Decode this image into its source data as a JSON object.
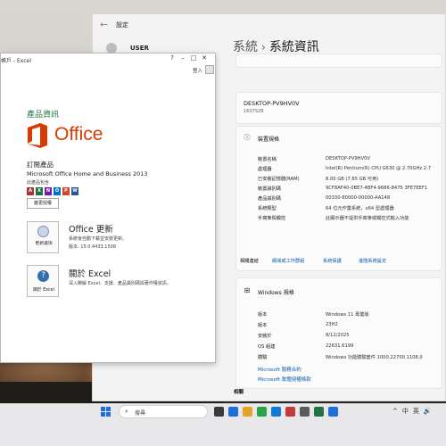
{
  "settings": {
    "title": "設定",
    "user": "USER",
    "breadcrumb_root": "系統",
    "breadcrumb_sep": "›",
    "breadcrumb_page": "系統資訊",
    "device_name": "DESKTOP-PV9HV0V",
    "device_model": "1607S2B",
    "device_specs_heading": "裝置規格",
    "specs": [
      {
        "key": "裝置名稱",
        "value": "DESKTOP-PV9HV0V"
      },
      {
        "key": "處理器",
        "value": "Intel(R) Pentium(R) CPU G630 @ 2.70GHz   2.7"
      },
      {
        "key": "已安裝記憶體(RAM)",
        "value": "8.00 GB (7.85 GB 可用)"
      },
      {
        "key": "裝置識別碼",
        "value": "9CF8AF40-0BE7-4BF4-9686-8475 3FE7EEF1"
      },
      {
        "key": "產品識別碼",
        "value": "00330-80000-00000-AA148"
      },
      {
        "key": "系統類型",
        "value": "64 位元作業系統，x64 型處理器"
      },
      {
        "key": "手寫筆與觸控",
        "value": "此顯示器不提供手寫筆或觸控式輸入功能"
      }
    ],
    "related_links_label": "相關連結",
    "related_links": [
      "網域或工作群組",
      "系統保護",
      "進階系統設定"
    ],
    "windows_specs_heading": "Windows 規格",
    "win_specs": [
      {
        "key": "版本",
        "value": "Windows 11 專業版"
      },
      {
        "key": "版本",
        "value": "23H2"
      },
      {
        "key": "安裝於",
        "value": "8/12/2025"
      },
      {
        "key": "OS 組建",
        "value": "22631.6199"
      },
      {
        "key": "體驗",
        "value": "Windows 功能體驗套件 1000.22700.1108.0"
      }
    ],
    "links": [
      "Microsoft 服務合約",
      "Microsoft 軟體授權條款"
    ],
    "related_footer": "相關"
  },
  "excel": {
    "title": "帳戶 - Excel",
    "controls": [
      "?",
      "–",
      "□",
      "✕"
    ],
    "signin": "登入",
    "heading": "產品資訊",
    "office_word": "Office",
    "product_label": "訂閱產品",
    "product_name": "Microsoft Office Home and Business 2013",
    "contains": "此產品包含",
    "app_letters": [
      "A",
      "X",
      "N",
      "O",
      "P",
      "W"
    ],
    "app_colors": [
      "#a4373a",
      "#217346",
      "#7719aa",
      "#0072c6",
      "#d24726",
      "#2b579a"
    ],
    "change_license": "變更授權",
    "update_tile_label": "更新選項",
    "update_heading": "Office 更新",
    "update_desc1": "系統會自動下載並安裝更新。",
    "update_desc2": "版本: 15.0.4433.1508",
    "about_tile_label": "關於 Excel",
    "about_heading": "關於 Excel",
    "about_desc": "深入瞭解 Excel、支援、產品識別碼與著作權資訊。"
  },
  "taskbar": {
    "search_placeholder": "搜尋",
    "app_icon_colors": [
      "#3a3a3a",
      "#1e6fd9",
      "#e0a42a",
      "#2aa34a",
      "#0f7bd6",
      "#c23b3b",
      "#5b5b5b",
      "#217346",
      "#1e6fd9"
    ],
    "tray": [
      "^",
      "中",
      "英",
      "🔊"
    ]
  }
}
